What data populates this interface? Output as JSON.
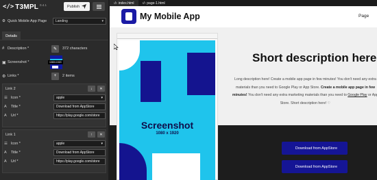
{
  "brand": {
    "logo": "</>",
    "name": "T3MPL",
    "version": "0.4.1"
  },
  "toolbar": {
    "publish_label": "Publish"
  },
  "quick_page": {
    "label": "Quick Mobile App Page",
    "value": "Landing"
  },
  "tabs": {
    "details": "Details"
  },
  "props": {
    "description": {
      "label": "Description *",
      "value": "372 characters"
    },
    "screenshot": {
      "label": "Screenshot *",
      "tooltip": "1080×1920"
    },
    "links": {
      "label": "Links *",
      "value": "2 items"
    }
  },
  "link_cards": [
    {
      "title": "Link 2",
      "icon_label": "Icon *",
      "icon_value": "apple",
      "title_label": "Title *",
      "title_value": "Download from AppStore",
      "url_label": "Url *",
      "url_value": "https://play.google.com/store"
    },
    {
      "title": "Link 1",
      "icon_label": "Icon *",
      "icon_value": "apple",
      "title_label": "Title *",
      "title_value": "Download from AppStore",
      "url_label": "Url *",
      "url_value": "https://play.google.com/store"
    }
  ],
  "file_tabs": [
    "index.html",
    "page-1.html"
  ],
  "preview": {
    "app_title": "My Mobile App",
    "nav_page": "Page",
    "hero_title": "Short description here!",
    "desc_part1": "Long description here! Create a mobile app page in few minutes! You don't need any extra",
    "desc_part2": "materials than you need to Google Play or App Store. ",
    "desc_bold": "Create a mobile app page in few minutes!",
    "desc_part3": " You don't need any extra marketing materials than you need to ",
    "desc_link": "Google Play",
    "desc_part4": " or App Store. Short description here! ♡",
    "screenshot_label": "Screenshot",
    "screenshot_size": "1080 x 1920",
    "store_buttons": [
      "Download from AppStore",
      "Download from AppStore"
    ]
  },
  "colors": {
    "accent": "#1a1aa5",
    "phone_bg": "#1fc4ec",
    "panel": "#2b2b2b"
  },
  "icons": [
    "code-icon",
    "send-icon",
    "menu-icon",
    "hash-icon",
    "edit-icon",
    "image-icon",
    "plus-icon",
    "list-icon",
    "arrow-down-icon",
    "close-icon",
    "text-icon",
    "link-icon",
    "apple-icon"
  ]
}
